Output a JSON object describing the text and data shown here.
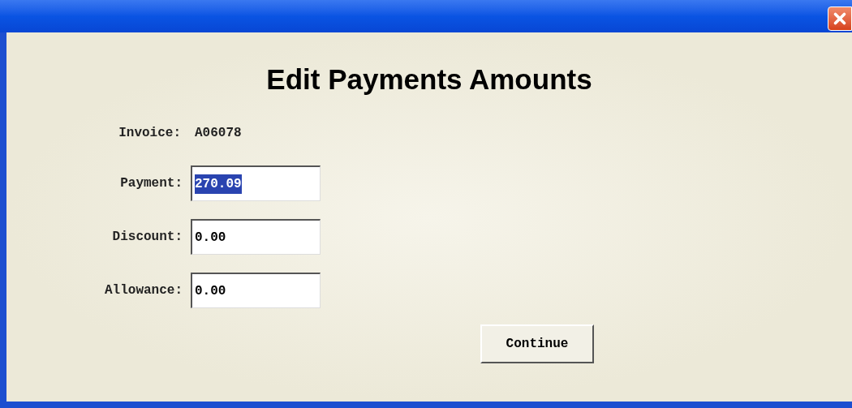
{
  "dialog": {
    "heading": "Edit Payments Amounts",
    "invoice": {
      "label": "Invoice:",
      "value": "A06078"
    },
    "fields": [
      {
        "label": "Payment:",
        "value": "270.09",
        "selected": true
      },
      {
        "label": "Discount:",
        "value": "0.00",
        "selected": false
      },
      {
        "label": "Allowance:",
        "value": "0.00",
        "selected": false
      }
    ],
    "buttons": [
      {
        "label": "Continue"
      }
    ]
  }
}
